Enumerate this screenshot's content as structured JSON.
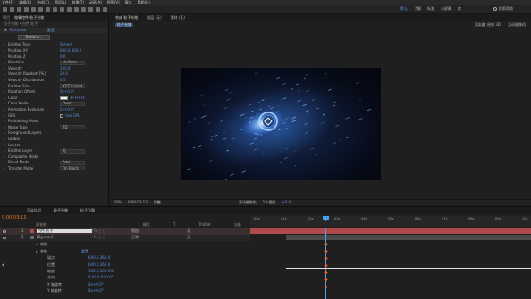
{
  "menu": {
    "items": [
      "文件(F)",
      "编辑(E)",
      "合成(C)",
      "图层(L)",
      "效果(T)",
      "动画(A)",
      "视图(V)",
      "窗口",
      "帮助(H)"
    ]
  },
  "toolbar": {
    "workspace_items": [
      "默认",
      "了解",
      "标准",
      "小屏幕",
      "库"
    ],
    "search_label": "搜索帮助"
  },
  "effects_panel": {
    "tabs": [
      {
        "label": "项目",
        "active": false
      },
      {
        "label": "效果控件 粒子光效",
        "active": true
      }
    ],
    "breadcrumb": "粒子光效 • 白色 粒子",
    "header_label": "Particular",
    "header_right": "重置",
    "options_button": "Options...",
    "rows": [
      {
        "label": "Emitter Type",
        "value": "Sphere"
      },
      {
        "label": "Position XY",
        "value": "640.0,360.0"
      },
      {
        "label": "Position Z",
        "value": "0.0"
      },
      {
        "label": "Direction",
        "value": "Uniform"
      },
      {
        "label": "Velocity",
        "value": "100.0"
      },
      {
        "label": "Velocity Random [%]",
        "value": "20.0"
      },
      {
        "label": "Velocity Distribution",
        "value": "0.5"
      },
      {
        "label": "Emitter Size",
        "value": "XYZ Linked"
      },
      {
        "label": "Rotation Offset",
        "value": "0x+0.0°"
      },
      {
        "label": "Color",
        "value": "#FFFFFF"
      },
      {
        "label": "Color Mode",
        "value": "Over"
      },
      {
        "label": "Animation Evolution",
        "value": "0x+0.0°"
      },
      {
        "label": "GPU",
        "value": "Use GPU"
      },
      {
        "label": "Positioning Mode",
        "value": ""
      },
      {
        "label": "Noise Type",
        "value": "2D"
      },
      {
        "label": "Foreground Layers",
        "value": ""
      },
      {
        "label": "Global",
        "value": ""
      },
      {
        "label": "Layers",
        "value": ""
      },
      {
        "label": "Emitter Layer",
        "value": "无"
      },
      {
        "label": "Composite Mode",
        "value": ""
      },
      {
        "label": "Blend Mode",
        "value": "Add"
      },
      {
        "label": "Transfer Mode",
        "value": "On Black"
      }
    ]
  },
  "viewer": {
    "tab_label": "合成 粒子光效",
    "extra_tabs": [
      "图层 (无)",
      "素材 (无)"
    ],
    "breadcrumb": "粒子光效",
    "renderer_label": "渲染器: 经典 3D",
    "camera_label": "活动摄像机",
    "footer": {
      "zoom": "50%",
      "timecode": "0:00:03:13",
      "resolution": "完整",
      "camera": "活动摄像机",
      "views": "1个视图",
      "exposure": "+0.0"
    }
  },
  "timeline": {
    "tabs": [
      {
        "label": "渲染队列",
        "active": false
      },
      {
        "label": "粒子光效",
        "active": true
      },
      {
        "label": "粒子飞舞",
        "active": false
      }
    ],
    "timecode": "0:00:03:13",
    "ruler": [
      "00s",
      "01s",
      "02s",
      "03s",
      "04s",
      "05s",
      "06s",
      "07s",
      "08s",
      "09s",
      "10s"
    ],
    "columns": [
      "源名称",
      "模式",
      "T",
      "TrkMat",
      "父级"
    ],
    "layers": [
      {
        "num": "1",
        "name": "白色 粒子",
        "mode": "相加",
        "parent": "无"
      },
      {
        "num": "2",
        "name": "[Bg.mov]",
        "mode": "正常",
        "parent": "无"
      }
    ],
    "properties": [
      {
        "label": "效果",
        "value": ""
      },
      {
        "label": "变换",
        "value": "重置"
      },
      {
        "label": "锚点",
        "value": "640.0,360.0"
      },
      {
        "label": "位置",
        "value": "640.0,360.0"
      },
      {
        "label": "缩放",
        "value": "100.0,100.0%"
      },
      {
        "label": "方向",
        "value": "0.0°,0.0°,0.0°"
      },
      {
        "label": "X 轴旋转",
        "value": "0x+0.0°"
      },
      {
        "label": "Y 轴旋转",
        "value": "0x+0.0°"
      }
    ]
  },
  "colors": {
    "accent": "#5f8fd9",
    "layer_bar": "#b04a4a",
    "timecode": "#e07b2a",
    "playhead": "#4a9ff0"
  }
}
